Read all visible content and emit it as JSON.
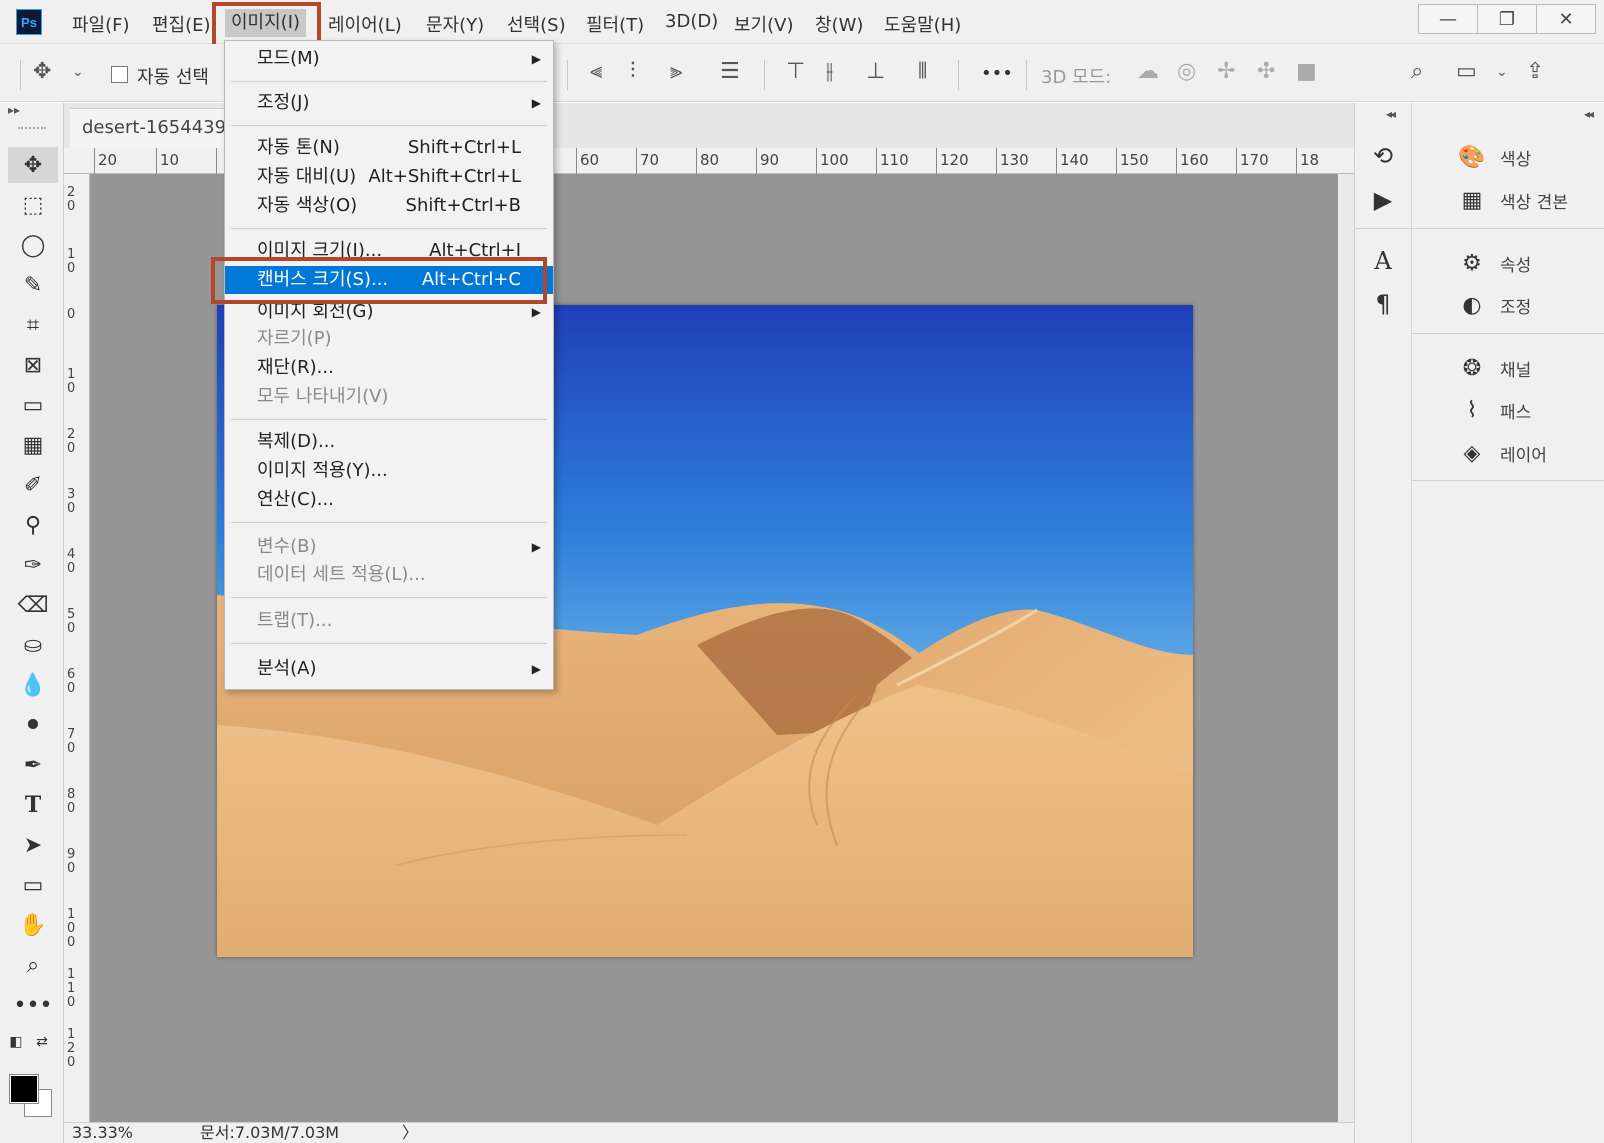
{
  "app": {
    "logo": "Ps",
    "menu": [
      "파일(F)",
      "편집(E)",
      "이미지(I)",
      "레이어(L)",
      "문자(Y)",
      "선택(S)",
      "필터(T)",
      "3D(D)",
      "보기(V)",
      "창(W)",
      "도움말(H)"
    ],
    "window_buttons": [
      "—",
      "❐",
      "✕"
    ]
  },
  "options_bar": {
    "auto_select_label": "자동  선택",
    "mode_3d_label": "3D 모드:",
    "more_label": "•••"
  },
  "document": {
    "tab_title": "desert-1654439_",
    "ruler_top": [
      "20",
      "10",
      "60",
      "70",
      "80",
      "90",
      "100",
      "110",
      "120",
      "130",
      "140",
      "150",
      "160",
      "170",
      "18"
    ],
    "ruler_left": [
      "20",
      "10",
      "0",
      "10",
      "20",
      "30",
      "40",
      "50",
      "60",
      "70",
      "80",
      "90",
      "100",
      "110",
      "120"
    ],
    "zoom": "33.33%",
    "doc_size": "문서:7.03M/7.03M",
    "status_arrow": "〉"
  },
  "image_menu": {
    "items": [
      {
        "label": "모드(M)",
        "shortcut": "",
        "submenu": true,
        "disabled": false
      },
      {
        "label": "조정(J)",
        "shortcut": "",
        "submenu": true,
        "disabled": false
      },
      {
        "label": "자동 톤(N)",
        "shortcut": "Shift+Ctrl+L",
        "submenu": false,
        "disabled": false
      },
      {
        "label": "자동 대비(U)",
        "shortcut": "Alt+Shift+Ctrl+L",
        "submenu": false,
        "disabled": false
      },
      {
        "label": "자동 색상(O)",
        "shortcut": "Shift+Ctrl+B",
        "submenu": false,
        "disabled": false
      },
      {
        "label": "이미지 크기(I)...",
        "shortcut": "Alt+Ctrl+I",
        "submenu": false,
        "disabled": false
      },
      {
        "label": "캔버스 크기(S)...",
        "shortcut": "Alt+Ctrl+C",
        "submenu": false,
        "disabled": false,
        "selected": true
      },
      {
        "label": "이미지 회전(G)",
        "shortcut": "",
        "submenu": true,
        "disabled": false
      },
      {
        "label": "자르기(P)",
        "shortcut": "",
        "submenu": false,
        "disabled": true
      },
      {
        "label": "재단(R)...",
        "shortcut": "",
        "submenu": false,
        "disabled": false
      },
      {
        "label": "모두 나타내기(V)",
        "shortcut": "",
        "submenu": false,
        "disabled": true
      },
      {
        "label": "복제(D)...",
        "shortcut": "",
        "submenu": false,
        "disabled": false
      },
      {
        "label": "이미지 적용(Y)...",
        "shortcut": "",
        "submenu": false,
        "disabled": false
      },
      {
        "label": "연산(C)...",
        "shortcut": "",
        "submenu": false,
        "disabled": false
      },
      {
        "label": "변수(B)",
        "shortcut": "",
        "submenu": true,
        "disabled": true
      },
      {
        "label": "데이터 세트 적용(L)...",
        "shortcut": "",
        "submenu": false,
        "disabled": true
      },
      {
        "label": "트랩(T)...",
        "shortcut": "",
        "submenu": false,
        "disabled": true
      },
      {
        "label": "분석(A)",
        "shortcut": "",
        "submenu": true,
        "disabled": false
      }
    ]
  },
  "panels": {
    "items": [
      "색상",
      "색상 견본",
      "속성",
      "조정",
      "채널",
      "패스",
      "레이어"
    ]
  },
  "colors": {
    "accent": "#0078d7",
    "highlight_box": "#b3472a",
    "canvas_bg": "#959595"
  }
}
